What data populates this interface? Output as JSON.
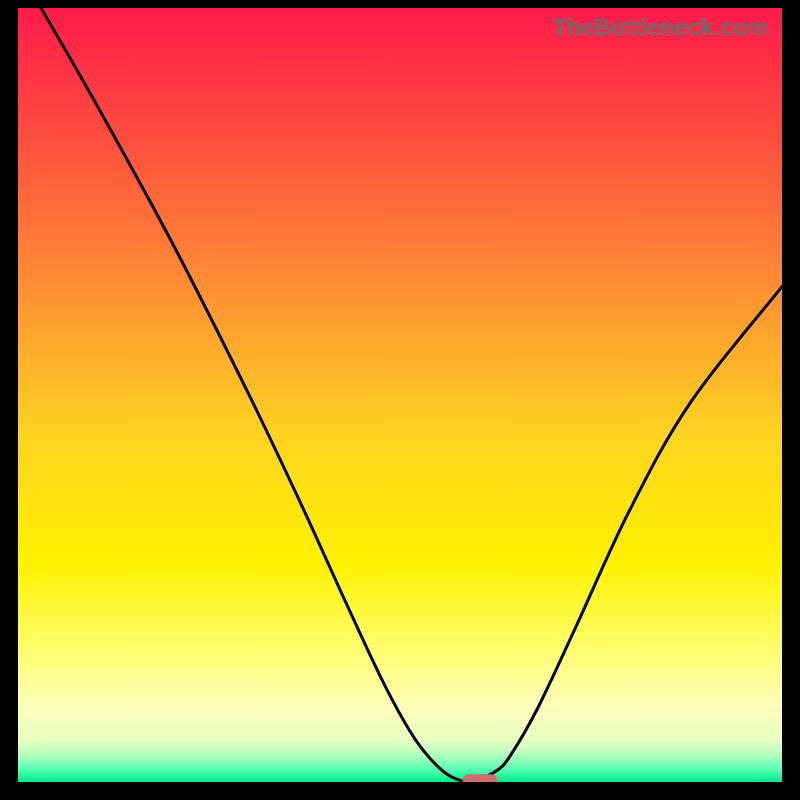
{
  "watermark": "TheBottleneck.com",
  "chart_data": {
    "type": "line",
    "title": "",
    "xlabel": "",
    "ylabel": "",
    "xlim": [
      0,
      100
    ],
    "ylim": [
      0,
      100
    ],
    "x": [
      3,
      10,
      20,
      30,
      37,
      43,
      48,
      52,
      55.5,
      58.2,
      59.7,
      62.7,
      64.5,
      68,
      73,
      80,
      88,
      100
    ],
    "y": [
      100,
      88,
      70,
      50.5,
      36,
      23,
      12.5,
      5.5,
      1.5,
      0.1,
      0.1,
      1.5,
      3.5,
      9.5,
      20,
      35,
      49,
      64
    ],
    "marker": {
      "x_range": [
        58.2,
        62.7
      ],
      "y": 0.1,
      "color": "#cf6d6e"
    },
    "gradient_stops": [
      {
        "pos": 0.0,
        "color": "#ff1b4a"
      },
      {
        "pos": 0.16,
        "color": "#ff4b3f"
      },
      {
        "pos": 0.35,
        "color": "#ff8b34"
      },
      {
        "pos": 0.55,
        "color": "#ffd321"
      },
      {
        "pos": 0.72,
        "color": "#fff200"
      },
      {
        "pos": 0.84,
        "color": "#ffff7a"
      },
      {
        "pos": 0.9,
        "color": "#ffffb8"
      },
      {
        "pos": 0.945,
        "color": "#e8ffbf"
      },
      {
        "pos": 0.965,
        "color": "#b2ffc0"
      },
      {
        "pos": 0.985,
        "color": "#4fffb2"
      },
      {
        "pos": 1.0,
        "color": "#00e88a"
      }
    ],
    "line_color": "#000000",
    "line_width": 3
  }
}
